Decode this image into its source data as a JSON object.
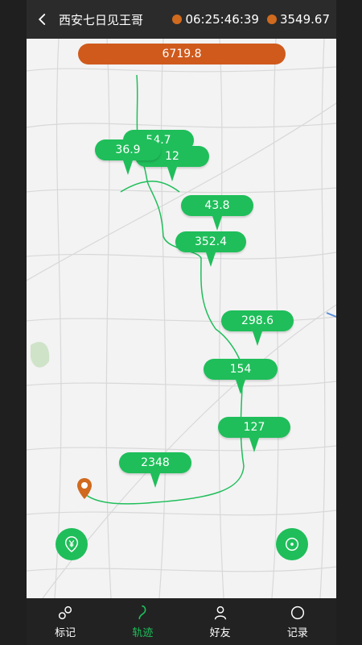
{
  "header": {
    "title": "西安七日见王哥",
    "time": "06:25:46:39",
    "distance": "3549.67",
    "time_icon": "clock-icon",
    "distance_icon": "distance-icon"
  },
  "map": {
    "total": "6719.8",
    "pins": [
      {
        "id": "p1",
        "label": "54.7"
      },
      {
        "id": "p2",
        "label": "36.9"
      },
      {
        "id": "p3",
        "label": "12"
      },
      {
        "id": "p4",
        "label": "43.8"
      },
      {
        "id": "p5",
        "label": "352.4"
      },
      {
        "id": "p6",
        "label": "298.6"
      },
      {
        "id": "p7",
        "label": "154"
      },
      {
        "id": "p8",
        "label": "127"
      },
      {
        "id": "p9",
        "label": "2348"
      }
    ]
  },
  "tabs": [
    {
      "label": "标记",
      "icon": "mark-icon"
    },
    {
      "label": "轨迹",
      "icon": "track-icon"
    },
    {
      "label": "好友",
      "icon": "friends-icon"
    },
    {
      "label": "记录",
      "icon": "record-icon"
    }
  ],
  "colors": {
    "accent": "#1fbe5a",
    "orange": "#cf5a1c"
  }
}
